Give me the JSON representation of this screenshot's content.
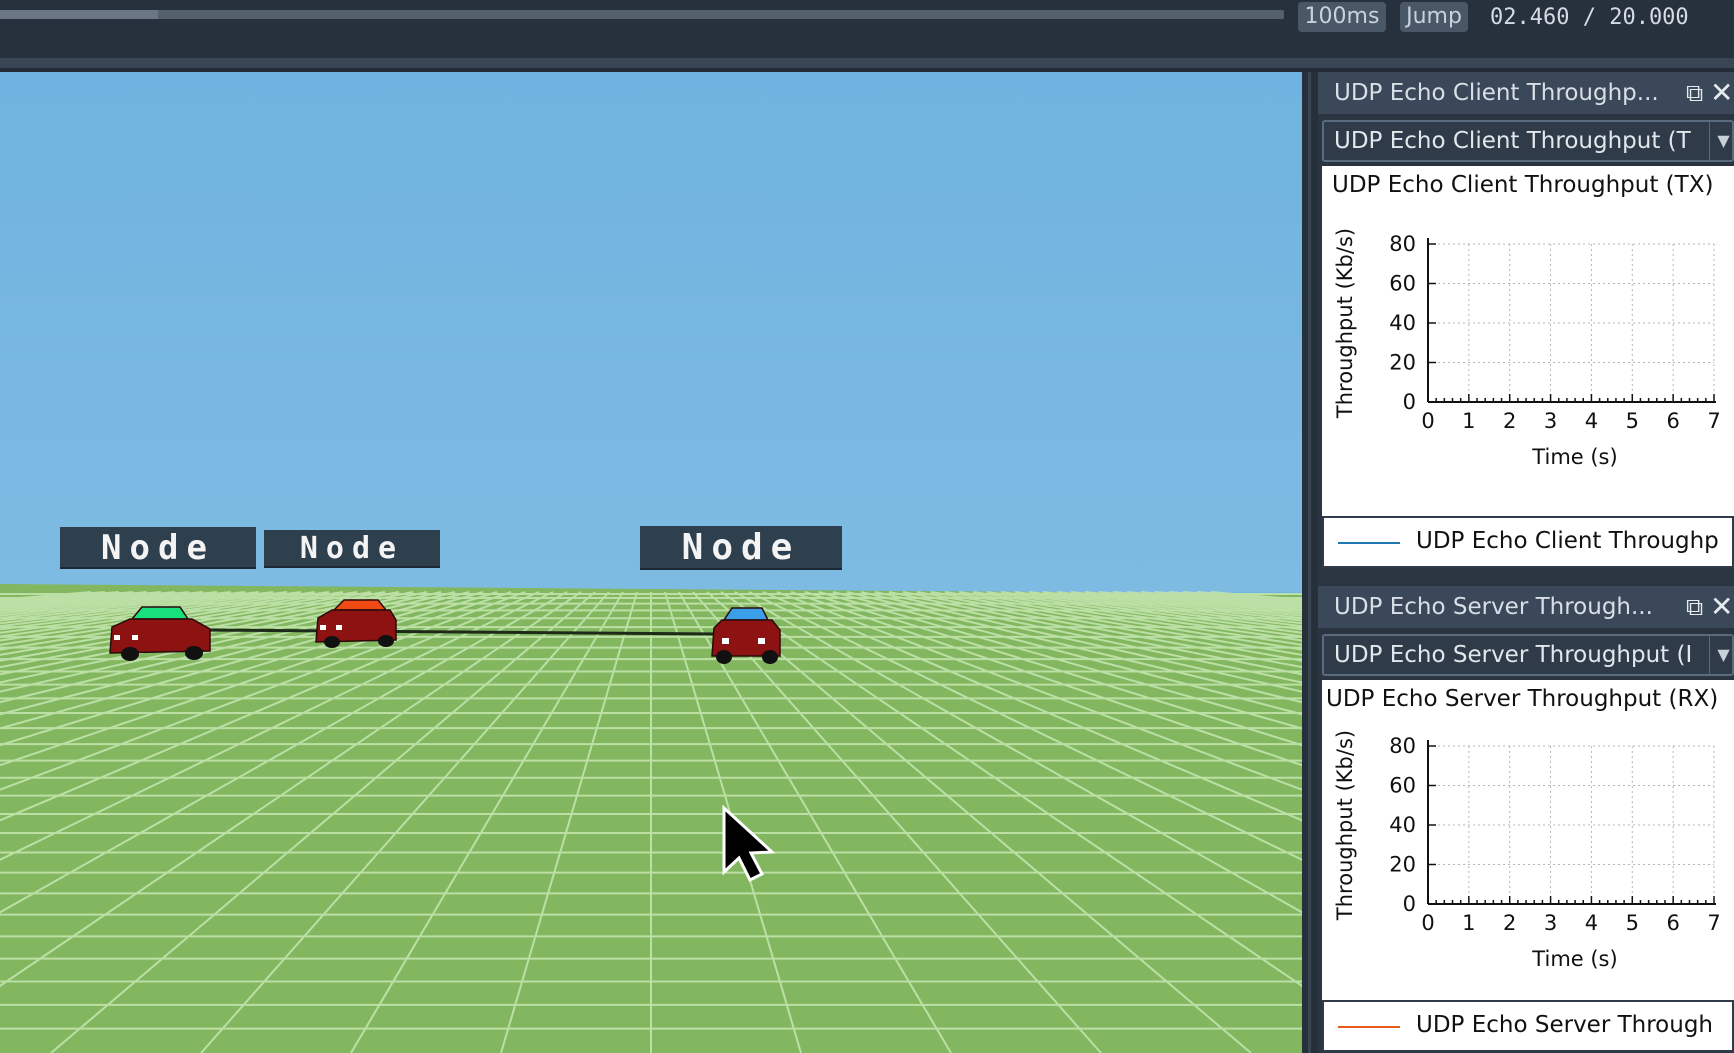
{
  "toolbar": {
    "playback_progress": 0.123,
    "speed_label": "100ms",
    "jump_label": "Jump",
    "time_readout": "02.460 / 20.000"
  },
  "viewport": {
    "node_labels": [
      "Node",
      "Node",
      "Node"
    ],
    "nodes": [
      {
        "roof_color": "#19e07a",
        "body_color": "#8d1212"
      },
      {
        "roof_color": "#f04a14",
        "body_color": "#8d1212"
      },
      {
        "roof_color": "#3a9ee8",
        "body_color": "#8d1212"
      }
    ],
    "sky_color": "#72b5e0",
    "ground_color": "#82b760"
  },
  "panels": {
    "client": {
      "title": "UDP Echo Client Throughp...",
      "selected_series": "UDP Echo Client Throughput (T",
      "plot_title": "UDP Echo Client Throughput (TX)",
      "legend": "UDP Echo Client Throughp",
      "legend_color": "#1f77b4"
    },
    "server": {
      "title": "UDP Echo Server Through...",
      "selected_series": "UDP Echo Server Throughput (I",
      "plot_title": "UDP Echo Server Throughput (RX)",
      "legend": "UDP Echo Server Through",
      "legend_color": "#e8591a"
    }
  },
  "chart_data": [
    {
      "type": "line",
      "title": "UDP Echo Client Throughput (TX)",
      "xlabel": "Time (s)",
      "ylabel": "Throughput (Kb/s)",
      "xlim": [
        0,
        7
      ],
      "ylim": [
        0,
        80
      ],
      "x_ticks": [
        "0",
        "1",
        "2",
        "3",
        "4",
        "5",
        "6",
        "7"
      ],
      "y_ticks": [
        "0",
        "20",
        "40",
        "60",
        "80"
      ],
      "grid": true,
      "series": [
        {
          "name": "UDP Echo Client Throughp",
          "x": [],
          "y": []
        }
      ]
    },
    {
      "type": "line",
      "title": "UDP Echo Server Throughput (RX)",
      "xlabel": "Time (s)",
      "ylabel": "Throughput (Kb/s)",
      "xlim": [
        0,
        7
      ],
      "ylim": [
        0,
        80
      ],
      "x_ticks": [
        "0",
        "1",
        "2",
        "3",
        "4",
        "5",
        "6",
        "7"
      ],
      "y_ticks": [
        "0",
        "20",
        "40",
        "60",
        "80"
      ],
      "grid": true,
      "series": [
        {
          "name": "UDP Echo Server Through",
          "x": [],
          "y": []
        }
      ]
    }
  ]
}
